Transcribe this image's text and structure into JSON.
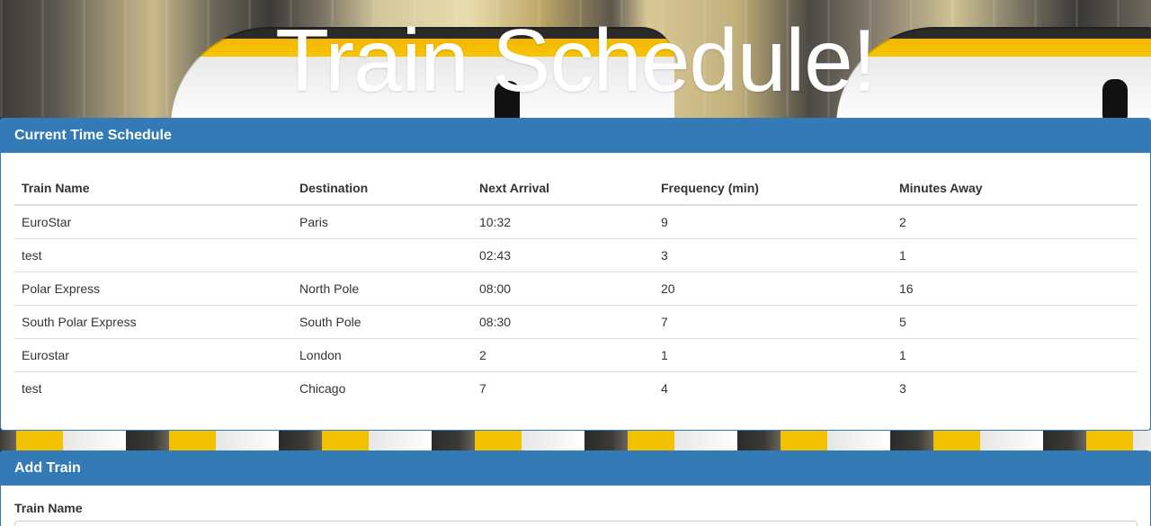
{
  "page": {
    "title": "Train Schedule!"
  },
  "schedule_panel": {
    "heading": "Current Time Schedule",
    "columns": [
      "Train Name",
      "Destination",
      "Next Arrival",
      "Frequency (min)",
      "Minutes Away"
    ],
    "rows": [
      [
        "EuroStar",
        "Paris",
        "10:32",
        "9",
        "2"
      ],
      [
        "test",
        "",
        "02:43",
        "3",
        "1"
      ],
      [
        "Polar Express",
        "North Pole",
        "08:00",
        "20",
        "16"
      ],
      [
        "South Polar Express",
        "South Pole",
        "08:30",
        "7",
        "5"
      ],
      [
        "Eurostar",
        "London",
        "2",
        "1",
        "1"
      ],
      [
        "test",
        "Chicago",
        "7",
        "4",
        "3"
      ]
    ]
  },
  "add_panel": {
    "heading": "Add Train",
    "train_name_label": "Train Name",
    "train_name_value": ""
  },
  "colors": {
    "panel_primary": "#337ab7",
    "title_text": "#ffffff"
  }
}
